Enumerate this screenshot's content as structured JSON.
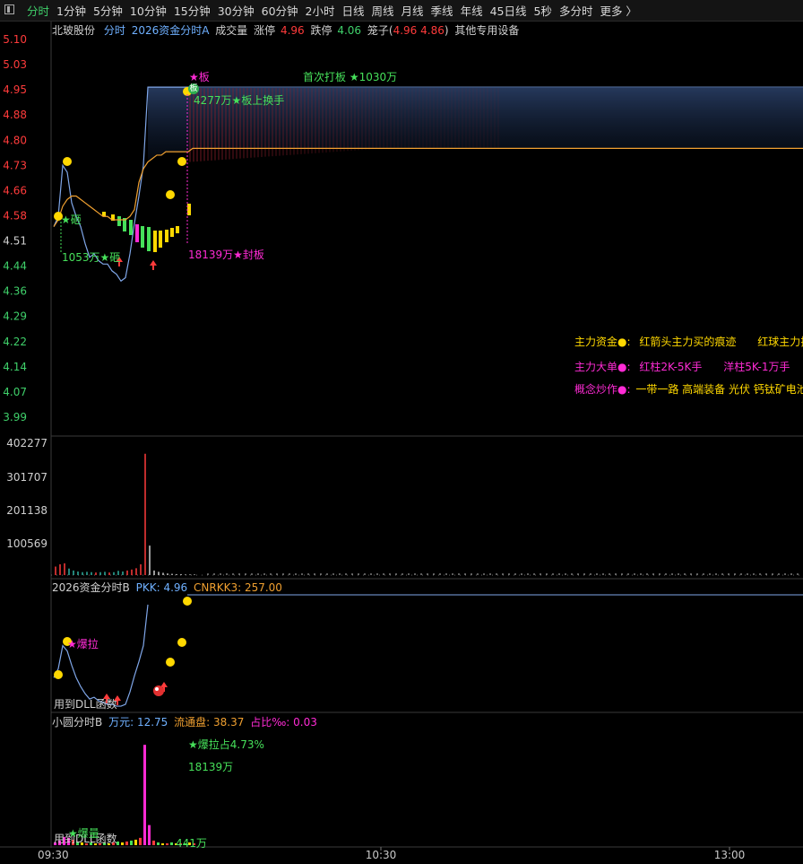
{
  "toolbar": {
    "tabs": [
      "分时",
      "1分钟",
      "5分钟",
      "10分钟",
      "15分钟",
      "30分钟",
      "60分钟",
      "2小时",
      "日线",
      "周线",
      "月线",
      "季线",
      "年线",
      "45日线",
      "5秒",
      "多分时",
      "更多 〉"
    ],
    "active": 0
  },
  "header": {
    "stock": "北玻股份",
    "mode": "分时",
    "indicator": "2026资金分时A",
    "volume_label": "成交量",
    "limit_up_label": "涨停",
    "limit_up_value": "4.96",
    "limit_down_label": "跌停",
    "limit_down_value": "4.06",
    "cage_prefix": "笼子(",
    "cage_a": "4.96",
    "cage_b": "4.86",
    "cage_suffix": ")",
    "sector": "其他专用设备"
  },
  "price_axis": [
    "5.10",
    "5.03",
    "4.95",
    "4.88",
    "4.80",
    "4.73",
    "4.66",
    "4.58",
    "4.51",
    "4.44",
    "4.36",
    "4.29",
    "4.22",
    "4.14",
    "4.07",
    "3.99"
  ],
  "volume_axis": [
    "402277",
    "301707",
    "201138",
    "100569"
  ],
  "time_axis": [
    "09:30",
    "10:30",
    "13:00"
  ],
  "price_annotations": {
    "ban": "★板",
    "first_board": "首次打板 ★1030万",
    "turnover": "4277万★板上换手",
    "seal": "18139万★封板",
    "left_mark": "★砸",
    "left_low": "1053万★砸",
    "ban_badge": "板"
  },
  "legend": {
    "row1_label": "主力资金●:",
    "row1_a": "红箭头主力买的痕迹",
    "row1_b": "红球主力拉",
    "row2_label": "主力大单●:",
    "row2_a": "红柱2K-5K手",
    "row2_b": "洋柱5K-1万手",
    "row3_label": "概念炒作●:",
    "row3_a": "一带一路 高端装备 光伏 钙钛矿电池"
  },
  "panel_b": {
    "title": "2026资金分时B",
    "pkk_label": "PKK:",
    "pkk_value": "4.96",
    "cnrkk_label": "CNRKK3:",
    "cnrkk_value": "257.00",
    "baola": "★爆拉",
    "dll_note": "用到DLL函数"
  },
  "panel_c": {
    "title": "小圆分时B",
    "wanyuan_label": "万元:",
    "wanyuan_value": "12.75",
    "float_label": "流通盘:",
    "float_value": "38.37",
    "ratio_label": "占比‰:",
    "ratio_value": "0.03",
    "baola_pct": "★爆拉占4.73%",
    "amount": "18139万",
    "bottom_note": "用到DLL函数",
    "bottom_mark": "★爆量",
    "bottom_amount": "441万"
  },
  "chart_data": [
    {
      "type": "line",
      "name_hint": "intraday price",
      "x": [
        "09:30",
        "09:31",
        "09:32",
        "09:33",
        "09:35",
        "09:37",
        "09:40",
        "09:42",
        "09:44",
        "09:46",
        "09:48",
        "09:50",
        "09:52",
        "09:54",
        "09:56",
        "09:58",
        "10:00",
        "10:02",
        "10:04",
        "10:06",
        "10:08",
        "10:10",
        "10:12",
        "10:14",
        "10:16",
        "10:18",
        "10:20",
        "10:21",
        "10:22",
        "10:23",
        "10:24",
        "10:25"
      ],
      "price": [
        4.55,
        4.58,
        4.73,
        4.71,
        4.62,
        4.58,
        4.55,
        4.5,
        4.46,
        4.47,
        4.45,
        4.44,
        4.44,
        4.42,
        4.41,
        4.39,
        4.4,
        4.47,
        4.56,
        4.64,
        4.73,
        4.96,
        4.96,
        4.96,
        4.96,
        4.96,
        4.96,
        4.96,
        4.96,
        4.96,
        4.96,
        4.96
      ],
      "avg": [
        4.55,
        4.57,
        4.61,
        4.63,
        4.64,
        4.64,
        4.63,
        4.62,
        4.61,
        4.6,
        4.59,
        4.58,
        4.58,
        4.57,
        4.57,
        4.57,
        4.57,
        4.58,
        4.6,
        4.68,
        4.72,
        4.74,
        4.75,
        4.76,
        4.76,
        4.77,
        4.77,
        4.77,
        4.77,
        4.77,
        4.77,
        4.78
      ],
      "ylim": [
        3.99,
        5.1
      ]
    },
    {
      "type": "bar",
      "name_hint": "volume",
      "values": [
        26000,
        33000,
        36000,
        20000,
        14000,
        11000,
        9000,
        10000,
        9000,
        8000,
        9000,
        10000,
        8000,
        9000,
        13000,
        11000,
        14000,
        17000,
        21000,
        33000,
        370000,
        90000,
        14000,
        10000,
        7000,
        5000,
        4000,
        3000,
        3000,
        2000,
        2000,
        2000
      ],
      "ylim": [
        0,
        402277
      ]
    },
    {
      "type": "line",
      "name_hint": "PKK",
      "values": [
        4.55,
        4.6,
        4.73,
        4.7,
        4.62,
        4.55,
        4.5,
        4.46,
        4.43,
        4.44,
        4.42,
        4.41,
        4.4,
        4.4,
        4.39,
        4.39,
        4.4,
        4.47,
        4.56,
        4.64,
        4.73,
        4.96
      ],
      "ylim": [
        4.36,
        4.98
      ]
    },
    {
      "type": "bar",
      "name_hint": "small-round B",
      "values": [
        3,
        5,
        9,
        8,
        6,
        4,
        3,
        2,
        3,
        2,
        2,
        3,
        2,
        3,
        4,
        3,
        4,
        5,
        6,
        8,
        110,
        22,
        5,
        3,
        2,
        2,
        3,
        2,
        2,
        2,
        3,
        2
      ],
      "ylim": [
        0,
        120
      ]
    }
  ],
  "colors": {
    "up": "#ff3b3b",
    "down": "#3fd06a",
    "price_line": "#7fa6e8",
    "avg_line": "#f0a030",
    "yellow": "#ffd800",
    "magenta": "#ff2bd5",
    "green_text": "#46e05a",
    "blue_text": "#6fb0ff",
    "orange_text": "#f0a030"
  }
}
